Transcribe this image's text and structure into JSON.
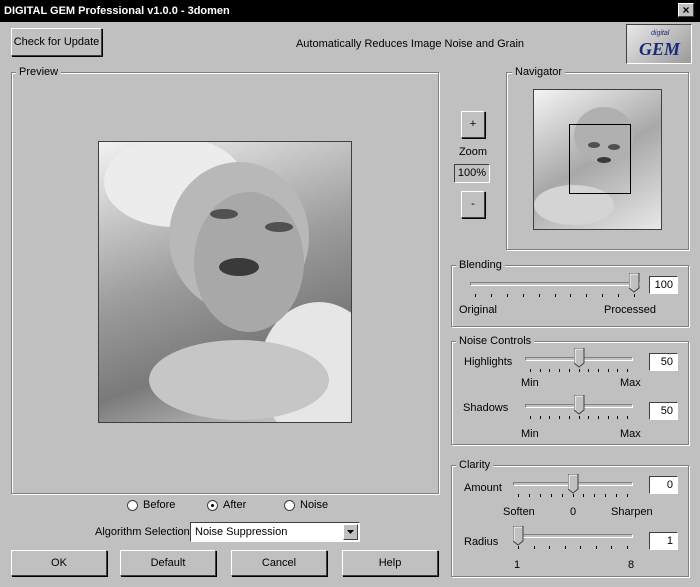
{
  "window": {
    "title": "DIGITAL GEM Professional  v1.0.0 - 3domen",
    "close_glyph": "×"
  },
  "header": {
    "check_update_label": "Check for Update",
    "tagline": "Automatically Reduces Image Noise and Grain",
    "logo_small": "digital",
    "logo_big": "GEM"
  },
  "preview": {
    "legend": "Preview"
  },
  "navigator": {
    "legend": "Navigator"
  },
  "zoom": {
    "plus_label": "+",
    "label": "Zoom",
    "value": "100%",
    "minus_label": "-"
  },
  "view_mode": {
    "options": [
      "Before",
      "After",
      "Noise"
    ],
    "selected": "After"
  },
  "algorithm": {
    "label": "Algorithm Selection",
    "value": "Noise Suppression"
  },
  "blending": {
    "legend": "Blending",
    "value": "100",
    "level": 100,
    "min_label": "Original",
    "max_label": "Processed"
  },
  "noise_controls": {
    "legend": "Noise Controls",
    "highlights": {
      "label": "Highlights",
      "value": "50",
      "level": 50,
      "min_label": "Min",
      "max_label": "Max"
    },
    "shadows": {
      "label": "Shadows",
      "value": "50",
      "level": 50,
      "min_label": "Min",
      "max_label": "Max"
    }
  },
  "clarity": {
    "legend": "Clarity",
    "amount": {
      "label": "Amount",
      "value": "0",
      "min": -10,
      "max": 10,
      "left_label": "Soften",
      "mid_label": "0",
      "right_label": "Sharpen"
    },
    "radius": {
      "label": "Radius",
      "value": "1",
      "min": 1,
      "max": 8,
      "left_label": "1",
      "right_label": "8"
    }
  },
  "footer": {
    "ok_label": "OK",
    "default_label": "Default",
    "cancel_label": "Cancel",
    "help_label": "Help"
  },
  "colors": {
    "title_bg": "#000000",
    "face": "#c0c0c0",
    "logo_text": "#1a2a7a"
  }
}
